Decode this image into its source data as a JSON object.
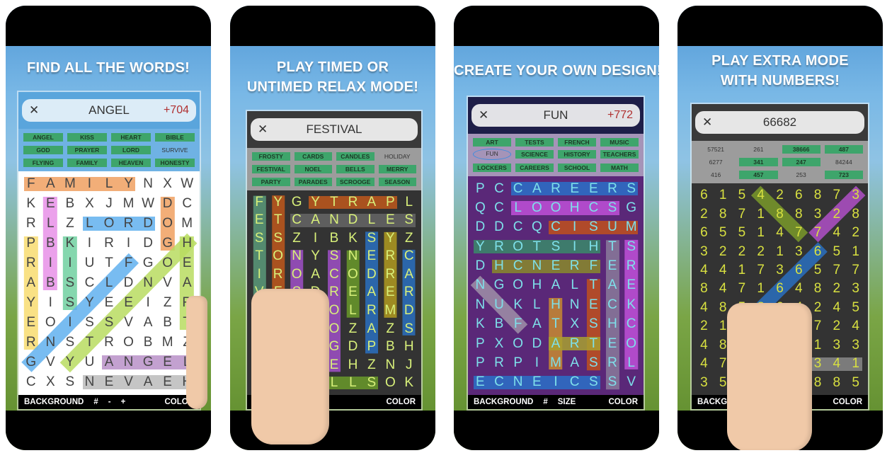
{
  "panels": [
    {
      "title": [
        "FIND ALL THE WORDS!"
      ],
      "header_word": "ANGEL",
      "score": "+704",
      "theme": {
        "header": "#5aa5dc",
        "pill": "#dcecf7",
        "list": "#6fb2e4",
        "grid": "#ffffff",
        "letter": "#444444"
      },
      "words": [
        {
          "text": "ANGEL",
          "found": true
        },
        {
          "text": "KISS",
          "found": true
        },
        {
          "text": "HEART",
          "found": true
        },
        {
          "text": "BIBLE",
          "found": true
        },
        {
          "text": "GOD",
          "found": true
        },
        {
          "text": "PRAYER",
          "found": true
        },
        {
          "text": "LORD",
          "found": true
        },
        {
          "text": "SURVIVE",
          "found": false
        },
        {
          "text": "FLYING",
          "found": true
        },
        {
          "text": "FAMILY",
          "found": true
        },
        {
          "text": "HEAVEN",
          "found": true
        },
        {
          "text": "HONESTY",
          "found": true
        }
      ],
      "grid": [
        "FAMILYNXW",
        "KEBXJMWDC",
        "RLZLORDOM",
        "PBKIRIDGH",
        "RIIUTFGOE",
        "ABSCLDNVA",
        "YISYEEIZR",
        "EOISSVABT",
        "RNSTROBMZ",
        "GVYUANGEL",
        "CXSNEVAEH"
      ],
      "highlights": [
        {
          "from": [
            0,
            0
          ],
          "to": [
            0,
            5
          ],
          "color": "#f0a060"
        },
        {
          "from": [
            1,
            1
          ],
          "to": [
            5,
            1
          ],
          "color": "#e890e8"
        },
        {
          "from": [
            2,
            3
          ],
          "to": [
            2,
            6
          ],
          "color": "#60b0ee"
        },
        {
          "from": [
            1,
            7
          ],
          "to": [
            3,
            7
          ],
          "color": "#f0a060"
        },
        {
          "from": [
            3,
            0
          ],
          "to": [
            8,
            0
          ],
          "color": "#f8dc70"
        },
        {
          "from": [
            3,
            2
          ],
          "to": [
            6,
            2
          ],
          "color": "#70d0a0"
        },
        {
          "from": [
            3,
            8
          ],
          "to": [
            7,
            8
          ],
          "color": "#b8dc60"
        },
        {
          "from": [
            4,
            5
          ],
          "to": [
            9,
            0
          ],
          "color": "#60b0ee"
        },
        {
          "from": [
            3,
            8
          ],
          "to": [
            9,
            2
          ],
          "color": "#b8dc60"
        },
        {
          "from": [
            9,
            4
          ],
          "to": [
            9,
            8
          ],
          "color": "#b890c8"
        },
        {
          "from": [
            10,
            3
          ],
          "to": [
            10,
            8
          ],
          "color": "#bbbbbb"
        }
      ],
      "toolbar": [
        "BACKGROUND",
        "#",
        "-",
        "+",
        "COLOR"
      ]
    },
    {
      "title": [
        "PLAY TIMED OR",
        "UNTIMED RELAX MODE!"
      ],
      "header_word": "FESTIVAL",
      "score": "",
      "theme": {
        "header": "#3a3a3a",
        "pill": "#e6e6e6",
        "list": "#9c9c9c",
        "grid": "#333333",
        "letter": "#d8f07a"
      },
      "words": [
        {
          "text": "FROSTY",
          "found": true
        },
        {
          "text": "CARDS",
          "found": true
        },
        {
          "text": "CANDLES",
          "found": true
        },
        {
          "text": "HOLIDAY",
          "found": false
        },
        {
          "text": "FESTIVAL",
          "found": true
        },
        {
          "text": "NOEL",
          "found": true
        },
        {
          "text": "BELLS",
          "found": true
        },
        {
          "text": "MERRY",
          "found": true
        },
        {
          "text": "PARTY",
          "found": true
        },
        {
          "text": "PARADES",
          "found": true
        },
        {
          "text": "SCROOGE",
          "found": true
        },
        {
          "text": "SEASON",
          "found": true
        }
      ],
      "grid": [
        "FYGYTRAPL",
        "ETCANDLES",
        "SSZIBKSYZ",
        "TONYSNERC",
        "IROACODRA",
        "VFSDREAER",
        "AFAIOLRMD",
        "LVELOZAZS",
        "LSSOGDPBH",
        "XZSHEHZNJ",
        "AXBELLSOK"
      ],
      "highlights": [
        {
          "from": [
            0,
            0
          ],
          "to": [
            7,
            0
          ],
          "color": "#5a9a7a"
        },
        {
          "from": [
            0,
            1
          ],
          "to": [
            5,
            1
          ],
          "color": "#c0581c"
        },
        {
          "from": [
            0,
            3
          ],
          "to": [
            0,
            7
          ],
          "color": "#c0581c"
        },
        {
          "from": [
            1,
            2
          ],
          "to": [
            1,
            8
          ],
          "color": "#666666"
        },
        {
          "from": [
            3,
            2
          ],
          "to": [
            8,
            2
          ],
          "color": "#a050c8"
        },
        {
          "from": [
            3,
            4
          ],
          "to": [
            9,
            4
          ],
          "color": "#a050c8"
        },
        {
          "from": [
            3,
            5
          ],
          "to": [
            6,
            5
          ],
          "color": "#6a9a2a"
        },
        {
          "from": [
            2,
            6
          ],
          "to": [
            8,
            6
          ],
          "color": "#2a70c0"
        },
        {
          "from": [
            2,
            7
          ],
          "to": [
            6,
            7
          ],
          "color": "#b09a20"
        },
        {
          "from": [
            3,
            8
          ],
          "to": [
            7,
            8
          ],
          "color": "#2a70c0"
        },
        {
          "from": [
            10,
            2
          ],
          "to": [
            10,
            6
          ],
          "color": "#6a9a2a"
        }
      ],
      "toolbar": [
        "SIZE",
        "COLOR"
      ]
    },
    {
      "title": [
        "CREATE YOUR OWN DESIGN!"
      ],
      "header_word": "FUN",
      "score": "+772",
      "theme": {
        "header": "#1e1e48",
        "pill": "#e2e2e6",
        "list": "#a594b8",
        "grid": "#5a2878",
        "letter": "#7ee0ea"
      },
      "words": [
        {
          "text": "ART",
          "found": true
        },
        {
          "text": "TESTS",
          "found": true
        },
        {
          "text": "FRENCH",
          "found": true
        },
        {
          "text": "MUSIC",
          "found": true
        },
        {
          "text": "FUN",
          "found": false,
          "circled": true
        },
        {
          "text": "SCIENCE",
          "found": true
        },
        {
          "text": "HISTORY",
          "found": true
        },
        {
          "text": "TEACHERS",
          "found": true
        },
        {
          "text": "LOCKERS",
          "found": true
        },
        {
          "text": "CAREERS",
          "found": true
        },
        {
          "text": "SCHOOL",
          "found": true
        },
        {
          "text": "MATH",
          "found": true
        }
      ],
      "grid": [
        "PCCAREERS",
        "QCLOOHCSG",
        "DDCQCISUM",
        "YROTSIHTS",
        "DHCNERFER",
        "NGOHALTAE",
        "NUKLHNECK",
        "KBFATXSHC",
        "PXODARTEO",
        "PRPIMASRL",
        "ECNEICSSV"
      ],
      "highlights": [
        {
          "from": [
            0,
            2
          ],
          "to": [
            0,
            8
          ],
          "color": "#2a70c8"
        },
        {
          "from": [
            1,
            2
          ],
          "to": [
            1,
            7
          ],
          "color": "#c050d8"
        },
        {
          "from": [
            2,
            4
          ],
          "to": [
            2,
            8
          ],
          "color": "#c0501c"
        },
        {
          "from": [
            3,
            0
          ],
          "to": [
            3,
            6
          ],
          "color": "#3a8a6a"
        },
        {
          "from": [
            4,
            1
          ],
          "to": [
            4,
            6
          ],
          "color": "#8a8a2a"
        },
        {
          "from": [
            3,
            7
          ],
          "to": [
            10,
            7
          ],
          "color": "#8a7a9a"
        },
        {
          "from": [
            3,
            8
          ],
          "to": [
            9,
            8
          ],
          "color": "#c050d8"
        },
        {
          "from": [
            5,
            6
          ],
          "to": [
            9,
            6
          ],
          "color": "#c0501c"
        },
        {
          "from": [
            6,
            4
          ],
          "to": [
            9,
            4
          ],
          "color": "#c88a30"
        },
        {
          "from": [
            8,
            4
          ],
          "to": [
            8,
            6
          ],
          "color": "#a8a030"
        },
        {
          "from": [
            5,
            0
          ],
          "to": [
            7,
            2
          ],
          "color": "#a090a8"
        },
        {
          "from": [
            10,
            0
          ],
          "to": [
            10,
            6
          ],
          "color": "#2a70c8"
        }
      ],
      "toolbar": [
        "BACKGROUND",
        "#",
        "SIZE",
        "COLOR"
      ]
    },
    {
      "title": [
        "PLAY EXTRA MODE",
        "WITH NUMBERS!"
      ],
      "header_word": "66682",
      "score": "",
      "theme": {
        "header": "#3a3a3a",
        "pill": "#e6e6e6",
        "list": "#9c9c9c",
        "grid": "#333333",
        "letter": "#d8e040"
      },
      "words": [
        {
          "text": "57521",
          "found": false
        },
        {
          "text": "261",
          "found": false
        },
        {
          "text": "38666",
          "found": true
        },
        {
          "text": "487",
          "found": true
        },
        {
          "text": "6277",
          "found": false
        },
        {
          "text": "341",
          "found": true
        },
        {
          "text": "247",
          "found": true
        },
        {
          "text": "84244",
          "found": false
        },
        {
          "text": "416",
          "found": false
        },
        {
          "text": "457",
          "found": true
        },
        {
          "text": "253",
          "found": false
        },
        {
          "text": "723",
          "found": true
        }
      ],
      "grid": [
        "615426873",
        "287188328",
        "655147742",
        "322213651",
        "441736577",
        "847164823",
        "485864245",
        "213172724",
        "484574133",
        "476227341",
        "354122885"
      ],
      "highlights": [
        {
          "from": [
            0,
            3
          ],
          "to": [
            2,
            5
          ],
          "color": "#7a9a2a"
        },
        {
          "from": [
            0,
            8
          ],
          "to": [
            2,
            6
          ],
          "color": "#b050c8"
        },
        {
          "from": [
            3,
            6
          ],
          "to": [
            7,
            2
          ],
          "color": "#2a70c0"
        },
        {
          "from": [
            8,
            2
          ],
          "to": [
            8,
            4
          ],
          "color": "#b0a030"
        },
        {
          "from": [
            9,
            6
          ],
          "to": [
            9,
            8
          ],
          "color": "#888888"
        },
        {
          "from": [
            10,
            5
          ],
          "to": [
            10,
            5
          ],
          "color": "#c0581c"
        }
      ],
      "toolbar": [
        "BACKGROUND",
        "COLOR"
      ]
    }
  ]
}
